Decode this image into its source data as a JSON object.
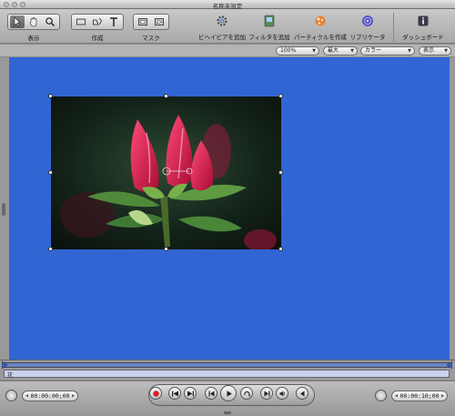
{
  "window": {
    "title": "名称未設定"
  },
  "toolbar": {
    "groups": [
      {
        "label": "表示"
      },
      {
        "label": "作成"
      },
      {
        "label": "マスク"
      }
    ],
    "actions": [
      {
        "label": "ビヘイビアを追加",
        "icon": "gear-icon"
      },
      {
        "label": "フィルタを追加",
        "icon": "filter-icon"
      },
      {
        "label": "パーティクルを作成",
        "icon": "particles-icon"
      },
      {
        "label": "リプリケータ",
        "icon": "replicator-icon"
      },
      {
        "label": "ダッシュボード",
        "icon": "info-icon"
      }
    ]
  },
  "options": {
    "zoom": "100%",
    "quality": "最大",
    "channel": "カラー",
    "view": "表示"
  },
  "timeline": {
    "track_label": "花"
  },
  "transport": {
    "current_time": "00:00:00;00",
    "duration": "00:00:10;00"
  },
  "colors": {
    "canvas": "#3165d4",
    "timeline_track": "#6b86c8",
    "record": "#d81f1f"
  }
}
